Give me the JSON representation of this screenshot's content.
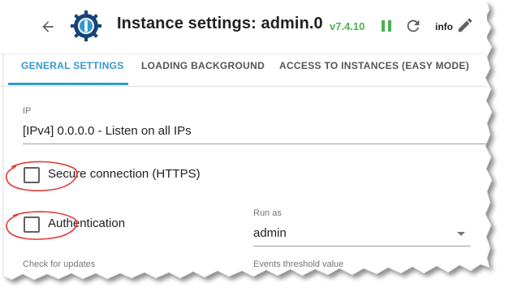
{
  "header": {
    "title": "Instance settings: admin.0",
    "version": "v7.4.10",
    "info_label": "info"
  },
  "tabs": [
    {
      "label": "GENERAL SETTINGS",
      "active": true
    },
    {
      "label": "LOADING BACKGROUND",
      "active": false
    },
    {
      "label": "ACCESS TO INSTANCES (EASY MODE)",
      "active": false
    }
  ],
  "form": {
    "ip": {
      "label": "IP",
      "value": "[IPv4] 0.0.0.0 - Listen on all IPs"
    },
    "secure": {
      "label": "Secure connection (HTTPS)",
      "checked": false
    },
    "auth": {
      "label": "Authentication",
      "checked": false
    },
    "run_as": {
      "label": "Run as",
      "value": "admin"
    },
    "check_updates": {
      "label": "Check for updates"
    },
    "events_threshold": {
      "label": "Events threshold value"
    }
  },
  "colors": {
    "accent": "#3399cc",
    "version_green": "#4caf50",
    "annotation_red": "#e53935"
  }
}
